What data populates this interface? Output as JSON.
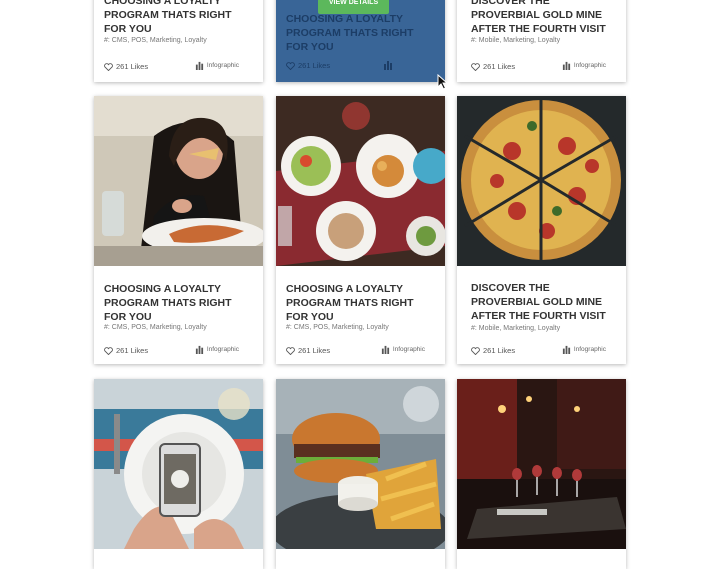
{
  "cards_top": [
    {
      "title": "Choosing a Loyalty Program Thats Right for You",
      "tags": "#: CMS, POS, Marketing, Loyalty",
      "likes": "261 Likes",
      "type": "Infographic"
    },
    {
      "title": "Choosing a Loyalty Program Thats Right for You",
      "tags": "",
      "likes": "261 Likes",
      "type": "",
      "button": "VIEW DETAILS"
    },
    {
      "title": "Discover the Proverbial Gold Mine After the Fourth Visit",
      "tags": "#: Mobile, Marketing, Loyalty",
      "likes": "261 Likes",
      "type": "Infographic"
    }
  ],
  "cards_middle": [
    {
      "title": "Choosing a Loyalty Program Thats Right for You",
      "tags": "#: CMS, POS, Marketing, Loyalty",
      "likes": "261 Likes",
      "type": "Infographic"
    },
    {
      "title": "Choosing a Loyalty Program Thats Right for You",
      "tags": "#: CMS, POS, Marketing, Loyalty",
      "likes": "261 Likes",
      "type": "Infographic"
    },
    {
      "title": "Discover the Proverbial Gold Mine After the Fourth Visit",
      "tags": "#: Mobile, Marketing, Loyalty",
      "likes": "261 Likes",
      "type": "Infographic"
    }
  ],
  "colors": {
    "overlay": "#24548c",
    "button": "#5cb85c"
  },
  "icons": [
    "heart-icon",
    "bar-chart-icon",
    "mouse-cursor-icon"
  ]
}
